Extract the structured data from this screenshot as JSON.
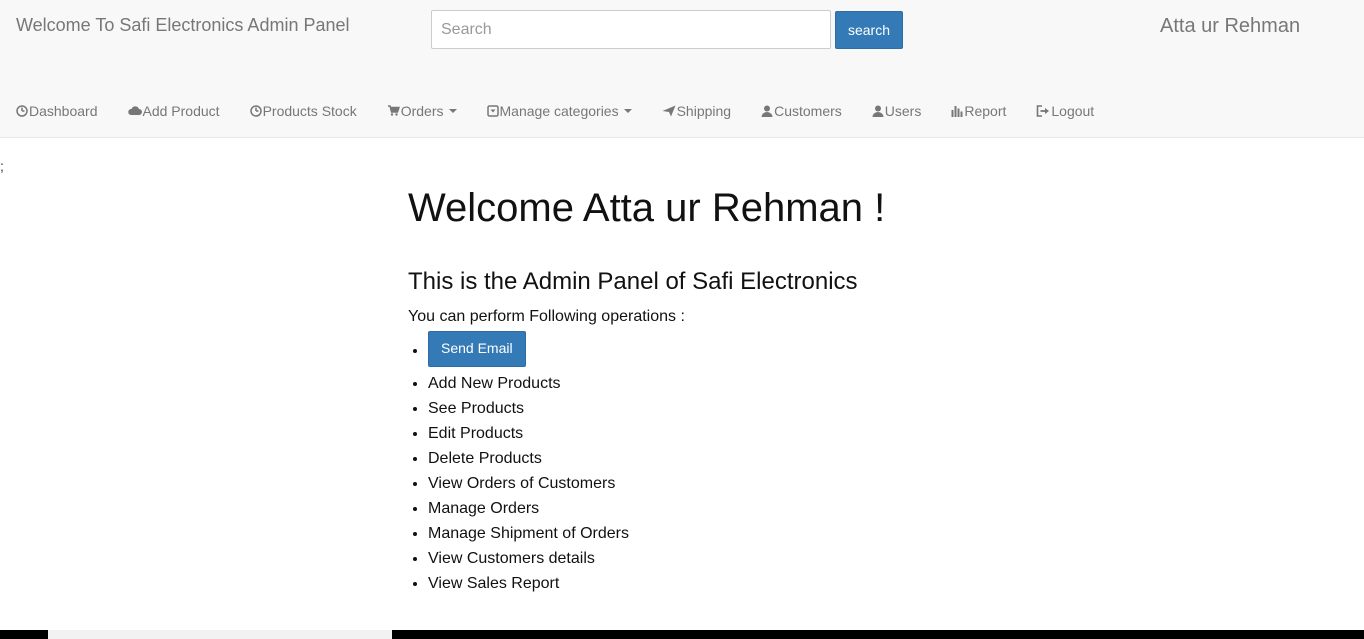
{
  "header": {
    "brand": "Welcome To Safi Electronics Admin Panel",
    "search_placeholder": "Search",
    "search_button": "search",
    "user_name": "Atta ur Rehman"
  },
  "nav": {
    "dashboard": "Dashboard",
    "add_product": "Add Product",
    "products_stock": "Products Stock",
    "orders": "Orders",
    "manage_categories": "Manage categories",
    "shipping": "Shipping",
    "customers": "Customers",
    "users": "Users",
    "report": "Report",
    "logout": "Logout"
  },
  "stray_text": ";",
  "main": {
    "title": "Welcome Atta ur Rehman !",
    "subtitle": "This is the Admin Panel of Safi Electronics",
    "intro": "You can perform Following operations :",
    "send_email_button": "Send Email",
    "operations": [
      "Add New Products",
      "See Products",
      "Edit Products",
      "Delete Products",
      "View Orders of Customers",
      "Manage Orders",
      "Manage Shipment of Orders",
      "View Customers details",
      "View Sales Report"
    ]
  },
  "colors": {
    "primary": "#337ab7",
    "navbar_bg": "#f8f8f8",
    "nav_text": "#777777"
  }
}
